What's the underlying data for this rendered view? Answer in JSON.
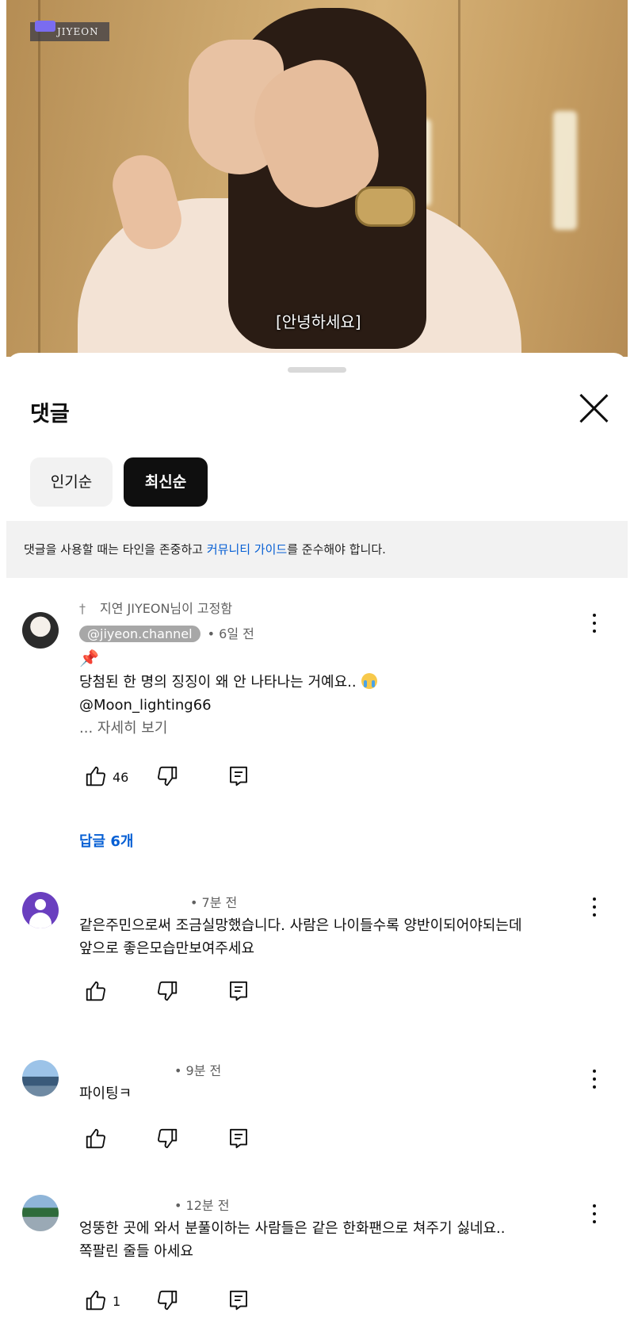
{
  "video": {
    "channel_logo_text": "JIYEON",
    "subtitle": "[안녕하세요]"
  },
  "comments_panel": {
    "title": "댓글",
    "sort_chips": [
      "인기순",
      "최신순"
    ],
    "selected_chip": "최신순",
    "notice_before": "댓글을 사용할 때는 타인을 존중하고 ",
    "notice_link": "커뮤니티 가이드",
    "notice_after": "를 준수해야 합니다."
  },
  "comments": [
    {
      "pinned_by": "지연 JIYEON님이 고정함",
      "handle": "@jiyeon.channel",
      "time": "• 6일 전",
      "lines": [
        "📌",
        "당첨된 한 명의 징징이 왜 안 나타나는 거예요..",
        "@Moon_lighting66"
      ],
      "more": "... 자세히 보기",
      "likes": "46",
      "replies_label": "답글 6개"
    },
    {
      "time": "• 7분 전",
      "lines": [
        "같은주민으로써 조금실망했습니다.  사람은 나이들수록 양반이되어야되는데",
        "앞으로 좋은모습만보여주세요"
      ],
      "likes": ""
    },
    {
      "time": "• 9분 전",
      "lines": [
        "파이팅ㅋ"
      ],
      "likes": ""
    },
    {
      "time": "• 12분 전",
      "lines": [
        "엉뚱한 곳에 와서 분풀이하는 사람들은 같은 한화팬으로 쳐주기 싫네요..",
        "쪽팔린 줄들 아세요"
      ],
      "likes": "1"
    }
  ],
  "icons": {
    "like": "thumbs-up-icon",
    "dislike": "thumbs-down-icon",
    "reply": "reply-icon",
    "more": "more-vert-icon",
    "close": "close-icon",
    "pin": "pin-icon"
  }
}
